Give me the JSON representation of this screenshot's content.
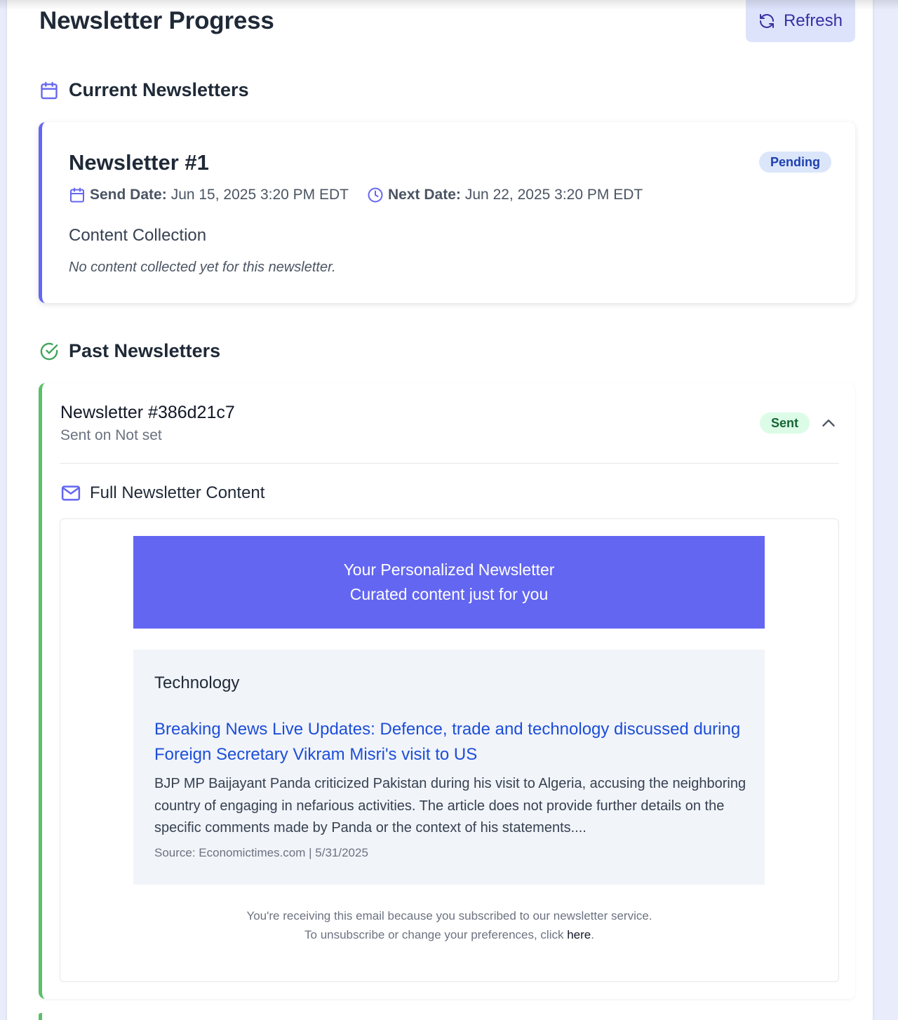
{
  "page": {
    "title": "Newsletter Progress",
    "refresh_label": "Refresh"
  },
  "current_section": {
    "heading": "Current Newsletters",
    "newsletter": {
      "title": "Newsletter #1",
      "status": "Pending",
      "send_date_label": "Send Date:",
      "send_date": "Jun 15, 2025 3:20 PM EDT",
      "next_date_label": "Next Date:",
      "next_date": "Jun 22, 2025 3:20 PM EDT",
      "content_heading": "Content Collection",
      "content_empty": "No content collected yet for this newsletter."
    }
  },
  "past_section": {
    "heading": "Past Newsletters",
    "newsletter": {
      "title": "Newsletter #386d21c7",
      "sent_on": "Sent on Not set",
      "status": "Sent",
      "full_content_heading": "Full Newsletter Content",
      "email": {
        "header_line1": "Your Personalized Newsletter",
        "header_line2": "Curated content just for you",
        "category": "Technology",
        "article_title": "Breaking News Live Updates: Defence, trade and technology discussed during Foreign Secretary Vikram Misri's visit to US",
        "article_summary": "BJP MP Baijayant Panda criticized Pakistan during his visit to Algeria, accusing the neighboring country of engaging in nefarious activities. The article does not provide further details on the specific comments made by Panda or the context of his statements....",
        "article_source": "Source: Economictimes.com | 5/31/2025",
        "footer_line1": "You're receiving this email because you subscribed to our newsletter service.",
        "footer_line2_prefix": "To unsubscribe or change your preferences, click ",
        "footer_link": "here",
        "footer_line2_suffix": "."
      }
    }
  },
  "colors": {
    "accent": "#6366f1",
    "success": "#5cbf6a",
    "link": "#1d4ed8",
    "pending_badge_bg": "#dbe6fb",
    "sent_badge_bg": "#dcfce7"
  },
  "icons": {
    "refresh": "refresh-icon",
    "current": "calendar-icon",
    "past": "check-circle-icon",
    "next_date": "clock-icon",
    "full_content": "mail-icon",
    "collapse": "chevron-up-icon"
  }
}
